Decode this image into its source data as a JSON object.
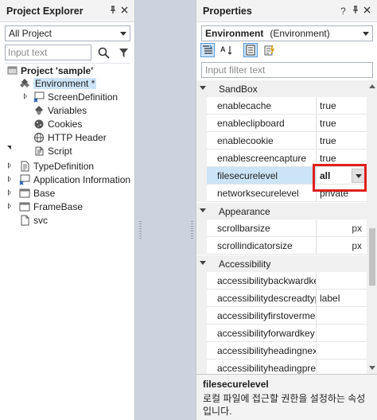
{
  "project_explorer": {
    "title": "Project Explorer",
    "scope_combo": "All Project",
    "filter_placeholder": "Input text",
    "tree": [
      {
        "label": "Project 'sample'",
        "bold": true,
        "icon": "project-icon"
      },
      {
        "label": "Environment *",
        "selected": true,
        "icon": "environment-icon"
      },
      {
        "label": "ScreenDefinition",
        "icon": "screen-definition-icon"
      },
      {
        "label": "Variables",
        "icon": "variables-icon"
      },
      {
        "label": "Cookies",
        "icon": "cookies-icon"
      },
      {
        "label": "HTTP Header",
        "icon": "http-header-icon"
      },
      {
        "label": "Script",
        "icon": "script-icon"
      },
      {
        "label": "TypeDefinition",
        "icon": "type-definition-icon"
      },
      {
        "label": "Application Information",
        "icon": "application-information-icon"
      },
      {
        "label": "Base",
        "icon": "base-icon"
      },
      {
        "label": "FrameBase",
        "icon": "framebase-icon"
      },
      {
        "label": "svc",
        "icon": "svc-icon"
      }
    ]
  },
  "properties": {
    "title": "Properties",
    "object_name": "Environment",
    "object_type": "(Environment)",
    "filter_placeholder": "Input filter text",
    "categories": [
      {
        "name": "SandBox",
        "rows": [
          {
            "name": "enablecache",
            "value": "true"
          },
          {
            "name": "enableclipboard",
            "value": "true"
          },
          {
            "name": "enablecookie",
            "value": "true"
          },
          {
            "name": "enablescreencapture",
            "value": "true"
          },
          {
            "name": "filesecurelevel",
            "value": "all",
            "selected": true,
            "dropdown": true
          },
          {
            "name": "networksecurelevel",
            "value": "private"
          }
        ]
      },
      {
        "name": "Appearance",
        "rows": [
          {
            "name": "scrollbarsize",
            "value": "",
            "unit": "px"
          },
          {
            "name": "scrollindicatorsize",
            "value": "",
            "unit": "px"
          }
        ]
      },
      {
        "name": "Accessibility",
        "rows": [
          {
            "name": "accessibilitybackwardkey",
            "value": ""
          },
          {
            "name": "accessibilitydescreadtype",
            "value": "label"
          },
          {
            "name": "accessibilityfirstovermessage",
            "value": ""
          },
          {
            "name": "accessibilityforwardkey",
            "value": ""
          },
          {
            "name": "accessibilityheadingnextkey",
            "value": ""
          },
          {
            "name": "accessibilityheadingprevkey",
            "value": ""
          }
        ]
      }
    ],
    "description": {
      "title": "filesecurelevel",
      "text": "로컬 파일에 접근할 권한을 설정하는 속성입니다."
    }
  },
  "colors": {
    "selection": "#cce4f7",
    "highlight_box": "#e0201a",
    "panel_gap": "#cdd3de"
  }
}
